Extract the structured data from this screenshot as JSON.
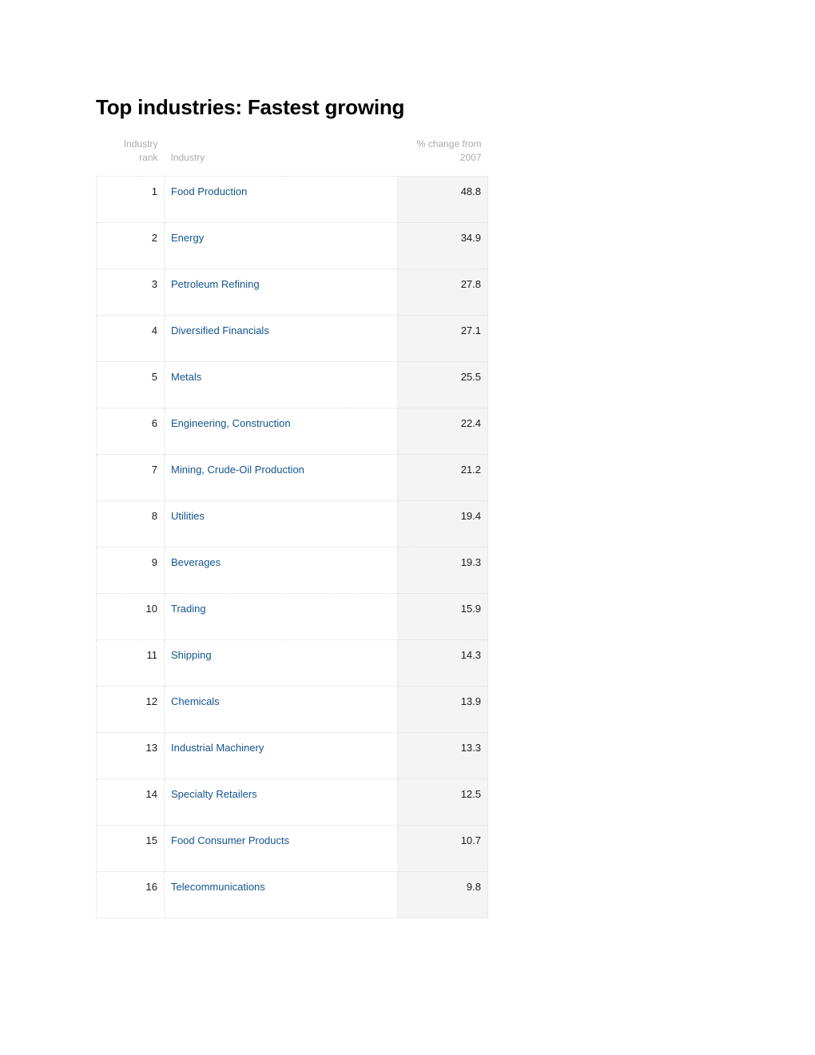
{
  "page": {
    "title": "Top industries: Fastest growing"
  },
  "table": {
    "headers": {
      "rank": "Industry rank",
      "industry": "Industry",
      "change": "% change from 2007"
    },
    "rows": [
      {
        "rank": "1",
        "industry": "Food Production",
        "change": "48.8"
      },
      {
        "rank": "2",
        "industry": "Energy",
        "change": "34.9"
      },
      {
        "rank": "3",
        "industry": "Petroleum Refining",
        "change": "27.8"
      },
      {
        "rank": "4",
        "industry": "Diversified Financials",
        "change": "27.1"
      },
      {
        "rank": "5",
        "industry": "Metals",
        "change": "25.5"
      },
      {
        "rank": "6",
        "industry": "Engineering, Construction",
        "change": "22.4"
      },
      {
        "rank": "7",
        "industry": "Mining, Crude-Oil Production",
        "change": "21.2"
      },
      {
        "rank": "8",
        "industry": "Utilities",
        "change": "19.4"
      },
      {
        "rank": "9",
        "industry": "Beverages",
        "change": "19.3"
      },
      {
        "rank": "10",
        "industry": "Trading",
        "change": "15.9"
      },
      {
        "rank": "11",
        "industry": "Shipping",
        "change": "14.3"
      },
      {
        "rank": "12",
        "industry": "Chemicals",
        "change": "13.9"
      },
      {
        "rank": "13",
        "industry": "Industrial Machinery",
        "change": "13.3"
      },
      {
        "rank": "14",
        "industry": "Specialty Retailers",
        "change": "12.5"
      },
      {
        "rank": "15",
        "industry": "Food Consumer Products",
        "change": "10.7"
      },
      {
        "rank": "16",
        "industry": "Telecommunications",
        "change": "9.8"
      }
    ]
  },
  "chart_data": {
    "type": "table",
    "title": "Top industries: Fastest growing",
    "columns": [
      "Industry rank",
      "Industry",
      "% change from 2007"
    ],
    "categories": [
      "Food Production",
      "Energy",
      "Petroleum Refining",
      "Diversified Financials",
      "Metals",
      "Engineering, Construction",
      "Mining, Crude-Oil Production",
      "Utilities",
      "Beverages",
      "Trading",
      "Shipping",
      "Chemicals",
      "Industrial Machinery",
      "Specialty Retailers",
      "Food Consumer Products",
      "Telecommunications"
    ],
    "values": [
      48.8,
      34.9,
      27.8,
      27.1,
      25.5,
      22.4,
      21.2,
      19.4,
      19.3,
      15.9,
      14.3,
      13.9,
      13.3,
      12.5,
      10.7,
      9.8
    ],
    "ranks": [
      1,
      2,
      3,
      4,
      5,
      6,
      7,
      8,
      9,
      10,
      11,
      12,
      13,
      14,
      15,
      16
    ],
    "xlabel": "Industry",
    "ylabel": "% change from 2007",
    "ylim": [
      0,
      50
    ]
  },
  "colors": {
    "link": "#15548f",
    "header_text": "#aaaaaa",
    "value_column_bg": "#f4f4f4",
    "border": "#dcdcdc",
    "title": "#000000"
  }
}
